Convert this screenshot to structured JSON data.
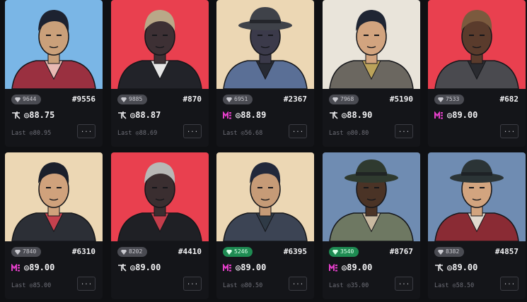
{
  "cards": [
    {
      "bg": "#7ab6e6",
      "rank": "9644",
      "green": false,
      "id": "#9556",
      "market": "tensor",
      "price": "◎88.75",
      "last": "Last ◎80.95",
      "more": "...",
      "skin": "#caa07a",
      "hair": "#1d2230",
      "coat": "#9a3040",
      "shirt": "#e9b9b3",
      "hat": false
    },
    {
      "bg": "#e9404f",
      "rank": "9885",
      "green": false,
      "id": "#870",
      "market": "tensor",
      "price": "◎88.87",
      "last": "Last ◎88.69",
      "more": "...",
      "skin": "#3d3034",
      "hair": "#b9a888",
      "coat": "#222329",
      "shirt": "#e6e6e6",
      "hat": false
    },
    {
      "bg": "#ecd7b4",
      "rank": "6951",
      "green": false,
      "id": "#2367",
      "market": "magiceden",
      "price": "◎88.89",
      "last": "Last ◎56.68",
      "more": "...",
      "skin": "#3b3a4a",
      "hair": "#3a3c44",
      "coat": "#5a6f96",
      "shirt": "#272a33",
      "hat": true,
      "hatColor": "#3f4249"
    },
    {
      "bg": "#e9e4da",
      "rank": "7968",
      "green": false,
      "id": "#5190",
      "market": "tensor",
      "price": "◎88.90",
      "last": "Last ◎80.80",
      "more": "...",
      "skin": "#d2a47f",
      "hair": "#1f2533",
      "coat": "#6b6760",
      "shirt": "#bba35a",
      "hat": false
    },
    {
      "bg": "#e9404f",
      "rank": "7533",
      "green": false,
      "id": "#682",
      "market": "magiceden",
      "price": "◎89.00",
      "last": "",
      "more": "...",
      "skin": "#5a3b2c",
      "hair": "#7b5a3e",
      "coat": "#4a4a4f",
      "shirt": "#2a2b30",
      "hat": false
    },
    {
      "bg": "#ecd7b4",
      "rank": "7840",
      "green": false,
      "id": "#6310",
      "market": "magiceden",
      "price": "◎89.00",
      "last": "Last ◎85.00",
      "more": "...",
      "skin": "#d0a27c",
      "hair": "#1b1f2b",
      "coat": "#2c2f36",
      "shirt": "#c6414e",
      "hat": false
    },
    {
      "bg": "#e9404f",
      "rank": "8202",
      "green": false,
      "id": "#4410",
      "market": "tensor",
      "price": "◎89.00",
      "last": "",
      "more": "...",
      "skin": "#3a2e30",
      "hair": "#b8b8b6",
      "coat": "#1f2025",
      "shirt": "#c33d4b",
      "hat": false
    },
    {
      "bg": "#ecd7b4",
      "rank": "5246",
      "green": true,
      "id": "#6395",
      "market": "magiceden",
      "price": "◎89.00",
      "last": "Last ◎80.50",
      "more": "...",
      "skin": "#c69b77",
      "hair": "#22283a",
      "coat": "#3c4454",
      "shirt": "#2f3a46",
      "hat": false
    },
    {
      "bg": "#6f8cb2",
      "rank": "3540",
      "green": true,
      "id": "#8767",
      "market": "magiceden",
      "price": "◎89.00",
      "last": "Last ◎35.00",
      "more": "...",
      "skin": "#4a3326",
      "hair": "#1a1a1a",
      "coat": "#6e7862",
      "shirt": "#c9b9a0",
      "hat": true,
      "hatColor": "#2f3a2f"
    },
    {
      "bg": "#6f8cb2",
      "rank": "8382",
      "green": false,
      "id": "#4857",
      "market": "tensor",
      "price": "◎89.00",
      "last": "Last ◎58.50",
      "more": "...",
      "skin": "#d2a47f",
      "hair": "#1a1a1a",
      "coat": "#8a2b34",
      "shirt": "#e2d9cf",
      "hat": true,
      "hatColor": "#2b3436"
    }
  ]
}
